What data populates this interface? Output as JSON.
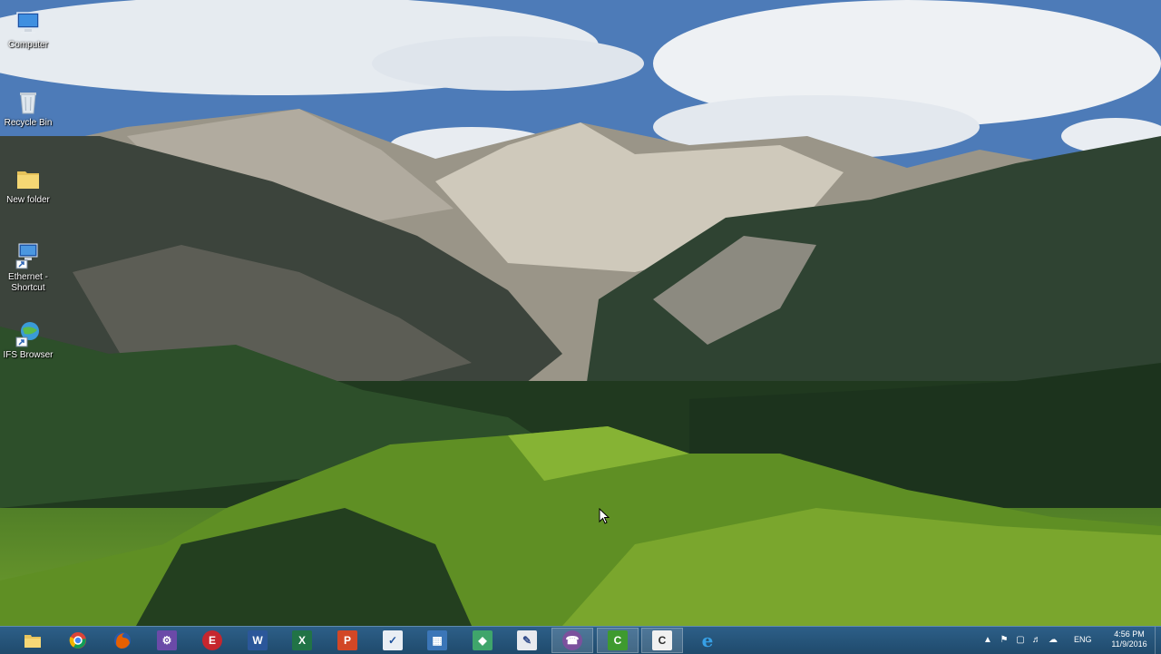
{
  "desktop_icons": [
    {
      "label": "Computer",
      "icon": "computer-icon"
    },
    {
      "label": "Recycle Bin",
      "icon": "recycle-bin-icon"
    },
    {
      "label": "New folder",
      "icon": "folder-icon"
    },
    {
      "label": "Ethernet - Shortcut",
      "icon": "network-shortcut-icon"
    },
    {
      "label": "IFS Browser",
      "icon": "ifs-browser-icon"
    }
  ],
  "taskbar": {
    "apps": [
      {
        "name": "file-explorer",
        "icon": "folder-icon"
      },
      {
        "name": "chrome",
        "icon": "chrome-icon"
      },
      {
        "name": "firefox",
        "icon": "firefox-icon"
      },
      {
        "name": "app-purple",
        "icon": "app-purple-icon"
      },
      {
        "name": "app-red-e",
        "icon": "app-red-e-icon"
      },
      {
        "name": "word",
        "icon": "word-icon",
        "letter": "W"
      },
      {
        "name": "excel",
        "icon": "excel-icon",
        "letter": "X"
      },
      {
        "name": "powerpoint",
        "icon": "powerpoint-icon",
        "letter": "P"
      },
      {
        "name": "app-check",
        "icon": "checkmark-app-icon"
      },
      {
        "name": "app-grid",
        "icon": "grid-app-icon"
      },
      {
        "name": "app-map",
        "icon": "map-app-icon"
      },
      {
        "name": "app-pen",
        "icon": "pen-app-icon"
      },
      {
        "name": "viber",
        "icon": "viber-icon"
      },
      {
        "name": "camtasia-green",
        "icon": "camtasia-icon"
      },
      {
        "name": "camtasia-dark",
        "icon": "camtasia-dark-icon"
      },
      {
        "name": "internet-explorer",
        "icon": "internet-explorer-icon"
      }
    ],
    "tray": {
      "language": "ENG",
      "time": "4:56 PM",
      "date": "11/9/2016"
    }
  },
  "colors": {
    "taskbar": "#2d5f88",
    "accent_word": "#2b579a",
    "accent_excel": "#217346",
    "accent_powerpoint": "#d24726"
  }
}
